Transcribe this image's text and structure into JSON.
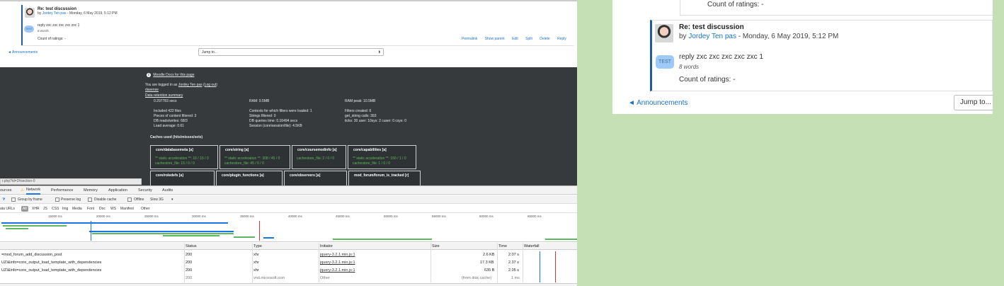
{
  "left": {
    "post": {
      "title": "Re: test discussion",
      "by": "by",
      "author": "Jordey Ten pas",
      "date": "- Monday, 6 May 2019, 5:12 PM",
      "badge": "TEST",
      "message": "reply zxc zxc zxc zxc zxc 1",
      "words": "8 words",
      "ratings": "Count of ratings: -",
      "actions": [
        "Permalink",
        "Show parent",
        "Edit",
        "Split",
        "Delete",
        "Reply"
      ]
    },
    "nav": {
      "prev": "◄ Announcements",
      "jump": "Jump to..."
    },
    "footer": {
      "docs_link": "Moodle Docs for this page",
      "logged_prefix": "You are logged in as",
      "user": "Jordey Ten pas",
      "logout": "Log out",
      "home": "dasense",
      "retention": "Data retention summary",
      "perf": {
        "secs": "0.297783 secs",
        "ram": "RAM: 9.5MB",
        "ram_peak": "RAM peak: 10.5MB",
        "col1": [
          "Included 422 files",
          "Pieces of content filtered: 3",
          "DB reads/writes: 68/3",
          "Load average: 0.61"
        ],
        "col2": [
          "Contexts for which filters were loaded: 1",
          "Strings filtered: 0",
          "DB queries time: 0.16494 secs",
          "Session (core\\session\\file): 4.5KB"
        ],
        "col3": [
          "Filters created: 6",
          "get_string calls: 393",
          "ticks: 30 user: 10sys: 2 cuser: 0 csys: 0"
        ]
      },
      "caches_title": "Caches used (hits/misses/sets)",
      "caches": [
        {
          "name": "core/databasemeta [a]",
          "l1": "** static acceleration **: 16 / 15 / 0",
          "l2": "cachestore_file: 15 / 0 / 0"
        },
        {
          "name": "core/string [a]",
          "l1": "** static acceleration **: 308 / 45 / 0",
          "l2": "cachestore_file: 45 / 0 / 0"
        },
        {
          "name": "core/coursemodinfo [a]",
          "l1": "cachestore_file: 2 / 0 / 0",
          "l2": ""
        },
        {
          "name": "core/capabilities [a]",
          "l1": "** static acceleration **: 150 / 1 / 0",
          "l2": "cachestore_file: 1 / 0 / 0"
        }
      ],
      "caches2": [
        "core/roledefs [a]",
        "core/plugin_functions [a]",
        "core/observers [a]",
        "mod_forum/forum_is_tracked [r]"
      ]
    },
    "url_fragment": "r.php?id=2#section-0",
    "devtools": {
      "tabs": [
        "ources",
        "Network",
        "Performance",
        "Memory",
        "Application",
        "Security",
        "Audits"
      ],
      "toolbar": {
        "group": "Group by frame",
        "preserve": "Preserve log",
        "disable_cache": "Disable cache",
        "offline": "Offline",
        "throttle": "Slow 3G"
      },
      "filters": [
        "ata URLs",
        "All",
        "XHR",
        "JS",
        "CSS",
        "Img",
        "Media",
        "Font",
        "Doc",
        "WS",
        "Manifest",
        "Other"
      ],
      "ticks": [
        "15000 ms",
        "20000 ms",
        "25000 ms",
        "30000 ms",
        "35000 ms",
        "40000 ms",
        "45000 ms",
        "50000 ms",
        "55000 ms",
        "60000 ms",
        "65000 ms"
      ],
      "columns": [
        "Status",
        "Type",
        "Initiator",
        "Size",
        "Time",
        "Waterfall"
      ],
      "rows": [
        {
          "name": "=mod_forum_add_discussion_post",
          "status": "200",
          "type": "xhr",
          "initiator": "jquery-3.2.1.min.js:1",
          "size": "2.6 KB",
          "time": "2.07 s"
        },
        {
          "name": "UZI&info=core_output_load_template_with_dependencies",
          "status": "200",
          "type": "xhr",
          "initiator": "jquery-3.2.1.min.js:1",
          "size": "17.3 KB",
          "time": "2.37 s"
        },
        {
          "name": "UZI&info=core_output_load_template_with_dependencies",
          "status": "200",
          "type": "xhr",
          "initiator": "jquery-3.2.1.min.js:1",
          "size": "635 B",
          "time": "2.05 s"
        },
        {
          "name": "",
          "status": "200",
          "type": "vnd.microsoft.icon",
          "initiator": "Other",
          "size": "(from disk cache)",
          "time": "1 ms"
        }
      ]
    }
  },
  "right": {
    "prev_ratings": "Count of ratings: -",
    "post": {
      "title": "Re: test discussion",
      "by": "by",
      "author": "Jordey Ten pas",
      "date": "- Monday, 6 May 2019, 5:12 PM",
      "badge": "TEST",
      "message": "reply zxc zxc zxc zxc zxc 1",
      "words": "8 words",
      "ratings": "Count of ratings: -"
    },
    "nav": {
      "prev": "◄ Announcements",
      "jump": "Jump to..."
    }
  }
}
